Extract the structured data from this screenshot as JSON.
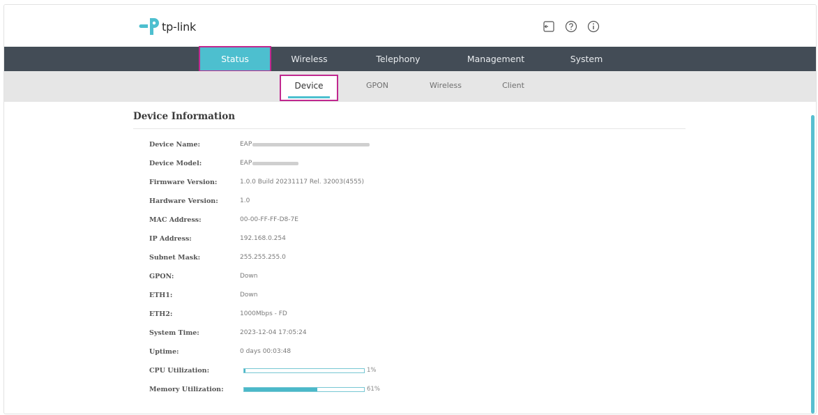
{
  "brand": {
    "name": "tp-link",
    "color": "#4dbfcf"
  },
  "header": {
    "icons": [
      "logout-icon",
      "help-icon",
      "info-icon"
    ]
  },
  "main_nav": {
    "items": [
      {
        "label": "Status",
        "active": true
      },
      {
        "label": "Wireless",
        "active": false
      },
      {
        "label": "Telephony",
        "active": false
      },
      {
        "label": "Management",
        "active": false
      },
      {
        "label": "System",
        "active": false
      }
    ]
  },
  "sub_nav": {
    "items": [
      {
        "label": "Device",
        "active": true
      },
      {
        "label": "GPON",
        "active": false
      },
      {
        "label": "Wireless",
        "active": false
      },
      {
        "label": "Client",
        "active": false
      }
    ]
  },
  "device_info": {
    "title": "Device Information",
    "rows": [
      {
        "label": "Device Name:",
        "value": "EAP"
      },
      {
        "label": "Device Model:",
        "value": "EAP"
      },
      {
        "label": "Firmware Version:",
        "value": "1.0.0 Build 20231117 Rel. 32003(4555)"
      },
      {
        "label": "Hardware Version:",
        "value": "1.0"
      },
      {
        "label": "MAC Address:",
        "value": "00-00-FF-FF-D8-7E"
      },
      {
        "label": "IP Address:",
        "value": "192.168.0.254"
      },
      {
        "label": "Subnet Mask:",
        "value": "255.255.255.0"
      },
      {
        "label": "GPON:",
        "value": "Down"
      },
      {
        "label": "ETH1:",
        "value": "Down"
      },
      {
        "label": "ETH2:",
        "value": "1000Mbps - FD"
      },
      {
        "label": "System Time:",
        "value": "2023-12-04 17:05:24"
      },
      {
        "label": "Uptime:",
        "value": "0 days 00:03:48"
      }
    ],
    "utilization": [
      {
        "label": "CPU Utilization:",
        "percent": 1,
        "text": "1%"
      },
      {
        "label": "Memory Utilization:",
        "percent": 61,
        "text": "61%"
      }
    ]
  },
  "colors": {
    "nav_bg": "#434c56",
    "accent": "#4dbfcf",
    "highlight_border": "#c0288f",
    "subnav_bg": "#e6e6e6"
  }
}
